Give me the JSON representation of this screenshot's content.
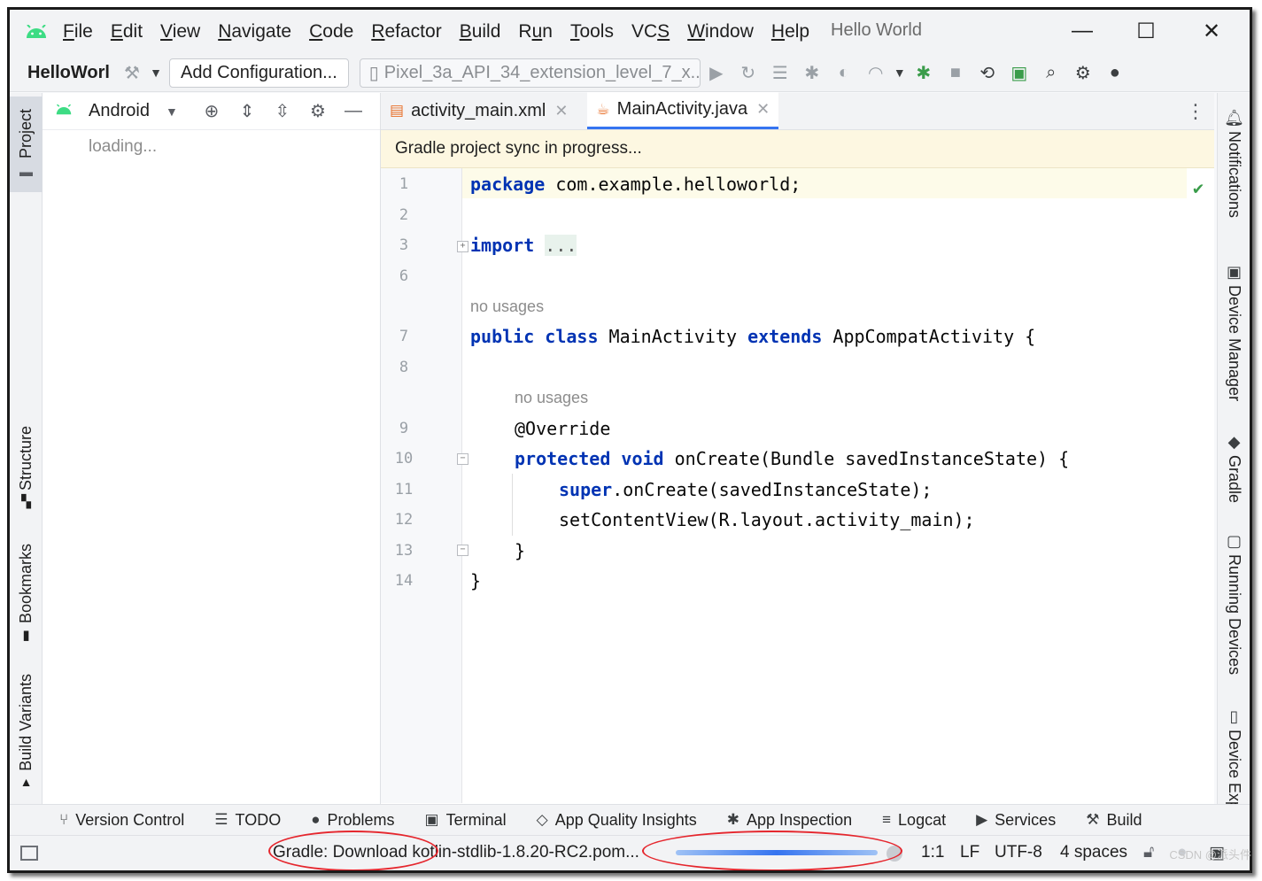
{
  "window": {
    "title": "Hello World",
    "controls": {
      "minimize": "—",
      "maximize": "☐",
      "close": "✕"
    }
  },
  "menu": [
    {
      "label": "File",
      "mnemonic": "F",
      "rest": "ile"
    },
    {
      "label": "Edit",
      "mnemonic": "E",
      "rest": "dit"
    },
    {
      "label": "View",
      "mnemonic": "V",
      "rest": "iew"
    },
    {
      "label": "Navigate",
      "mnemonic": "N",
      "rest": "avigate"
    },
    {
      "label": "Code",
      "mnemonic": "C",
      "rest": "ode"
    },
    {
      "label": "Refactor",
      "mnemonic": "R",
      "rest": "efactor"
    },
    {
      "label": "Build",
      "mnemonic": "B",
      "rest": "uild"
    },
    {
      "label": "Run",
      "pre": "R",
      "mnemonic": "u",
      "rest": "n"
    },
    {
      "label": "Tools",
      "mnemonic": "T",
      "rest": "ools"
    },
    {
      "label": "VCS",
      "pre": "VC",
      "mnemonic": "S",
      "rest": ""
    },
    {
      "label": "Window",
      "mnemonic": "W",
      "rest": "indow"
    },
    {
      "label": "Help",
      "mnemonic": "H",
      "rest": "elp"
    }
  ],
  "toolbar": {
    "project_name": "HelloWorl",
    "config_label": "Add Configuration...",
    "device_label": "Pixel_3a_API_34_extension_level_7_x..."
  },
  "left_strip": {
    "project": "Project",
    "structure": "Structure",
    "bookmarks": "Bookmarks",
    "build_variants": "Build Variants"
  },
  "project_panel": {
    "view_mode": "Android",
    "loading_text": "loading..."
  },
  "editor": {
    "tabs": [
      {
        "label": "activity_main.xml",
        "active": false
      },
      {
        "label": "MainActivity.java",
        "active": true
      }
    ],
    "banner": "Gradle project sync in progress...",
    "line_numbers": [
      "1",
      "2",
      "3",
      "6",
      "7",
      "8",
      "9",
      "10",
      "11",
      "12",
      "13",
      "14"
    ],
    "code": {
      "package_kw": "package",
      "package_name": " com.example.helloworld;",
      "import_kw": "import",
      "import_dots": "...",
      "no_usages_1": "no usages",
      "class_public": "public",
      "class_kw": "class",
      "class_name": " MainActivity ",
      "extends_kw": "extends",
      "class_parent": " AppCompatActivity {",
      "no_usages_2": "no usages",
      "override": "@Override",
      "protected_kw": "protected",
      "void_kw": "void",
      "method_sig": " onCreate(Bundle savedInstanceState) {",
      "super_kw": "super",
      "super_call": ".onCreate(savedInstanceState);",
      "set_content": "setContentView(R.layout.activity_main);",
      "close_method": "}",
      "close_class": "}"
    }
  },
  "right_strip": {
    "notifications": "Notifications",
    "device_manager": "Device Manager",
    "gradle": "Gradle",
    "running_devices": "Running Devices",
    "device_explorer": "Device Expl"
  },
  "bottom_tools": [
    {
      "label": "Version Control",
      "icon": "branch-icon"
    },
    {
      "label": "TODO",
      "icon": "list-icon"
    },
    {
      "label": "Problems",
      "icon": "problems-icon"
    },
    {
      "label": "Terminal",
      "icon": "terminal-icon"
    },
    {
      "label": "App Quality Insights",
      "icon": "gem-icon"
    },
    {
      "label": "App Inspection",
      "icon": "inspection-icon"
    },
    {
      "label": "Logcat",
      "icon": "logcat-icon"
    },
    {
      "label": "Services",
      "icon": "services-icon"
    },
    {
      "label": "Build",
      "icon": "hammer-icon"
    }
  ],
  "status": {
    "gradle_task": "Gradle: Download kotlin-stdlib-1.8.20-RC2.pom...",
    "progress": 1.0,
    "position": "1:1",
    "line_sep": "LF",
    "encoding": "UTF-8",
    "indent": "4 spaces"
  },
  "watermark": "CSDN @派头件",
  "colors": {
    "accent": "#3574f0",
    "keyword": "#0033b3",
    "banner": "#fdf7e1",
    "annotation_oval": "#e5262d",
    "android_green": "#3ddc84"
  }
}
